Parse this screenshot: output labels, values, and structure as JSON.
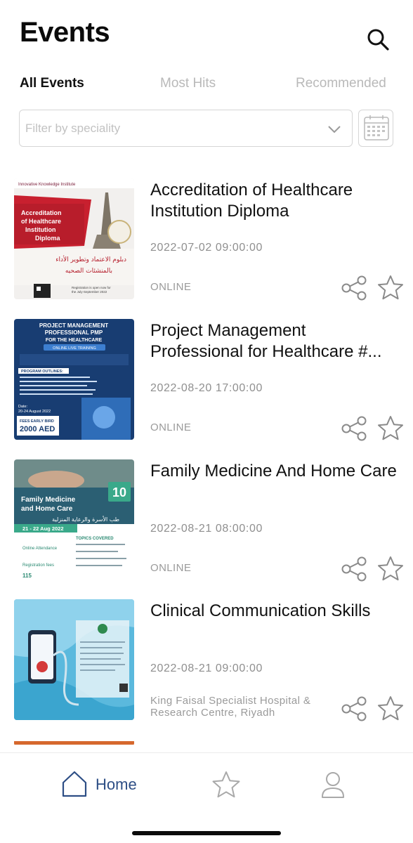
{
  "header": {
    "title": "Events",
    "search_icon": "search-icon"
  },
  "tabs": [
    {
      "label": "All Events",
      "active": true
    },
    {
      "label": "Most Hits",
      "active": false
    },
    {
      "label": "Recommended",
      "active": false
    }
  ],
  "filter": {
    "placeholder": "Filter by speciality",
    "value": ""
  },
  "events": [
    {
      "title": "Accreditation of Healthcare Institution Diploma",
      "date": "2022-07-02 09:00:00",
      "location": "ONLINE",
      "thumb": {
        "org": "Innovative Knowledge Institute",
        "heading": "Accreditation of Healthcare Institution Diploma",
        "arabic": "دبلوم الاعتماد وتطوير الأداء بالمنشئات الصحيه",
        "note": "Registration is open now for the July-September 2022 Semester The seats are limited"
      }
    },
    {
      "title": "Project Management Professional for Healthcare #...",
      "date": "2022-08-20 17:00:00",
      "location": "ONLINE",
      "thumb": {
        "heading": "PROJECT MANAGEMENT PROFESSIONAL PMP",
        "sub": "FOR THE HEALTHCARE",
        "mode": "ONLINE LIVE TRAINING",
        "outline": "PROGRAM OUTLINES:",
        "date": "20-24 August 2022",
        "fees_label": "FEES EARLY BIRD",
        "fees": "2000 AED"
      }
    },
    {
      "title": "Family Medicine And Home Care",
      "date": "2022-08-21 08:00:00",
      "location": "ONLINE",
      "thumb": {
        "badge": "10",
        "heading": "Family Medicine and Home Care",
        "arabic": "طب الأسرة والرعاية المنزلية",
        "dates": "21 - 22 Aug 2022",
        "topics": "TOPICS COVERED",
        "online": "Online Attendance",
        "fees_label": "Registration fees"
      }
    },
    {
      "title": "Clinical Communication Skills",
      "date": "2022-08-21 09:00:00",
      "location": "King Faisal Specialist Hospital & Research Centre, Riyadh",
      "thumb": {}
    }
  ],
  "bottom_nav": {
    "home_label": "Home",
    "items": [
      "home-icon",
      "star-icon",
      "profile-icon"
    ]
  },
  "colors": {
    "accent": "#2d4e85",
    "muted": "#8f8f8f",
    "tab_inactive": "#b9b9b9"
  }
}
